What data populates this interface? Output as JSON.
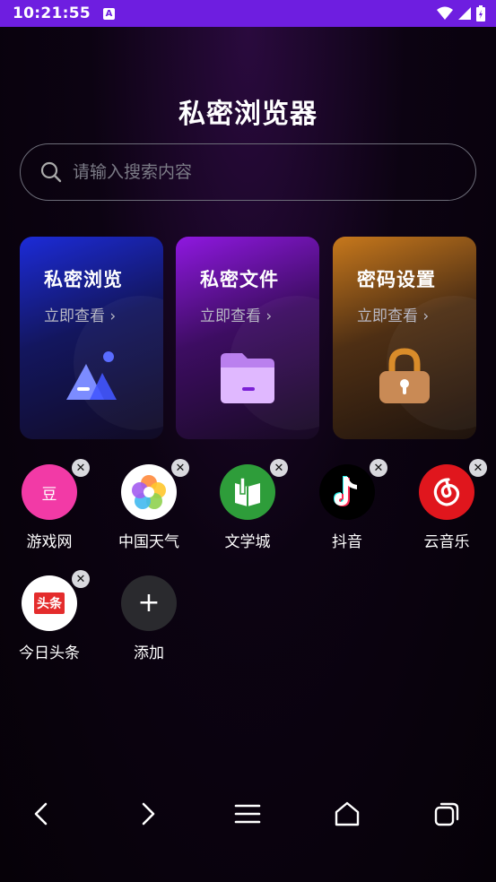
{
  "status_bar": {
    "time": "10:21:55",
    "notification_glyph": "A"
  },
  "app": {
    "title": "私密浏览器"
  },
  "search": {
    "placeholder": "请输入搜索内容"
  },
  "cards": [
    {
      "title": "私密浏览",
      "subtitle": "立即查看 ›",
      "icon": "mountain-icon"
    },
    {
      "title": "私密文件",
      "subtitle": "立即查看 ›",
      "icon": "folder-icon"
    },
    {
      "title": "密码设置",
      "subtitle": "立即查看 ›",
      "icon": "lock-icon"
    }
  ],
  "shortcuts": [
    {
      "label": "游戏网",
      "icon_text": "豆",
      "color": "#f23aa6"
    },
    {
      "label": "中国天气",
      "icon_text": "",
      "color": "#ffffff"
    },
    {
      "label": "文学城",
      "icon_text": "",
      "color": "#2e9d3a"
    },
    {
      "label": "抖音",
      "icon_text": "",
      "color": "#000000"
    },
    {
      "label": "云音乐",
      "icon_text": "",
      "color": "#e0161d"
    },
    {
      "label": "今日头条",
      "icon_text": "头条",
      "color": "#ffffff"
    },
    {
      "label": "添加",
      "icon_text": "+",
      "color": "#2a2a2e"
    }
  ],
  "bottom_nav": [
    "back-icon",
    "forward-icon",
    "menu-icon",
    "home-icon",
    "tabs-icon"
  ]
}
